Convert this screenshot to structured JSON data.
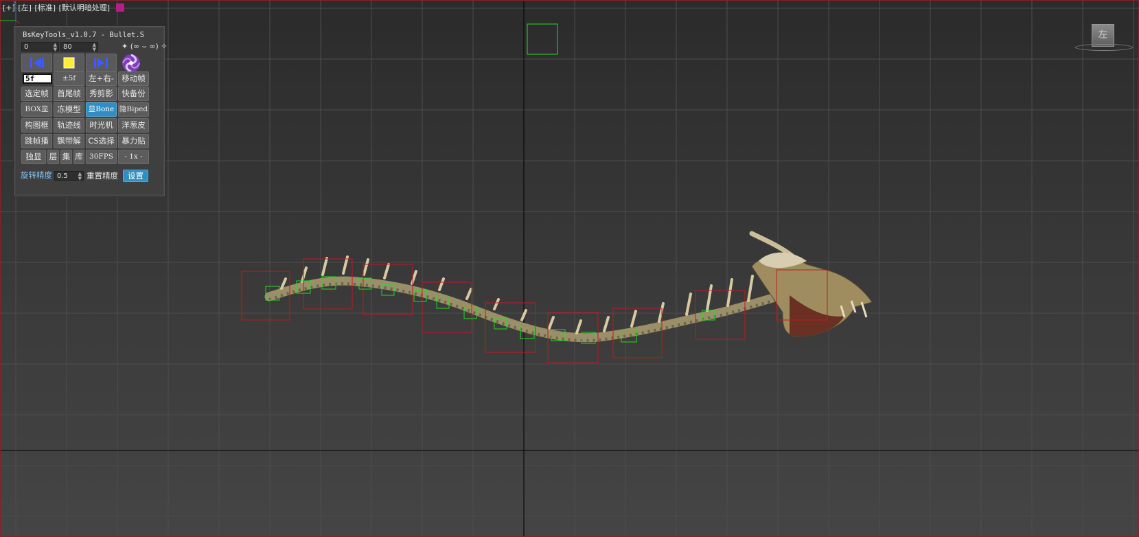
{
  "viewport": {
    "labels": [
      "[+]",
      "[左]",
      "[标准]",
      "[默认明暗处理]"
    ],
    "viewcube_face": "左",
    "axis_label": "z",
    "selection_color": "#b0208a",
    "bone_box_color": "#c0191f",
    "helper_box_color": "#22dd22"
  },
  "panel": {
    "title": "BsKeyTools_v1.0.7 - Bullet.S",
    "start_frame": "0",
    "end_frame": "80",
    "misc_icons": "✦  (∞ ⌣ ∞) ✧",
    "big_buttons": [
      {
        "name": "prev-key-icon"
      },
      {
        "name": "stop-icon"
      },
      {
        "name": "next-key-icon"
      },
      {
        "name": "swirl-logo-icon"
      }
    ],
    "frame_step": "5f",
    "rows": [
      [
        "±5f",
        "左+右-",
        "移动帧"
      ],
      [
        "选定帧",
        "首尾帧",
        "秀剪影",
        "快备份"
      ],
      [
        "BOX显",
        "冻模型",
        "显Bone",
        "隐Biped"
      ],
      [
        "构图框",
        "轨迹线",
        "时光机",
        "洋葱皮"
      ],
      [
        "跳帧播",
        "飘带解",
        "CS选择",
        "暴力贴"
      ],
      [
        "独显",
        "层",
        "集",
        "库",
        "30FPS",
        "- 1x -"
      ]
    ],
    "rotation_precision_label": "旋转精度",
    "rotation_precision_value": "0.5",
    "reset_precision_label": "重置精度",
    "settings_label": "设置"
  }
}
